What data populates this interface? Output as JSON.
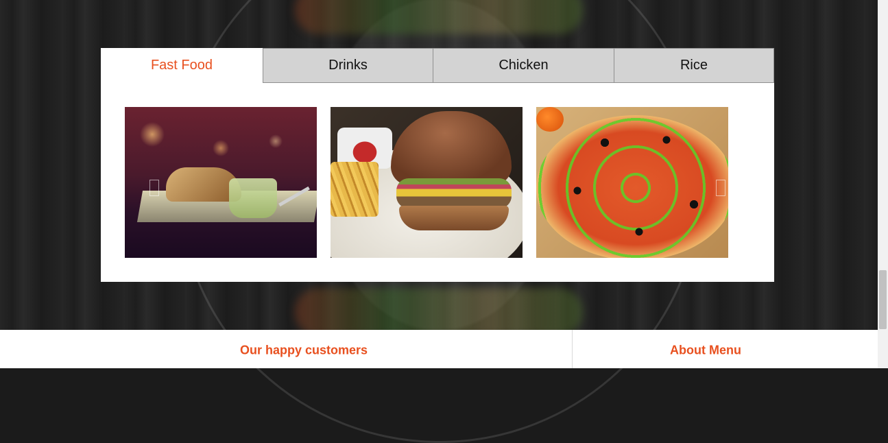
{
  "menu": {
    "tabs": [
      {
        "label": "Fast Food",
        "active": true
      },
      {
        "label": "Drinks",
        "active": false
      },
      {
        "label": "Chicken",
        "active": false
      },
      {
        "label": "Rice",
        "active": false
      }
    ],
    "accent_color": "#e8501f",
    "gallery": [
      {
        "subject": "bread-with-dip"
      },
      {
        "subject": "burger-with-fries"
      },
      {
        "subject": "pizza"
      }
    ]
  },
  "footer": {
    "left_heading": "Our happy customers",
    "right_heading": "About Menu"
  }
}
